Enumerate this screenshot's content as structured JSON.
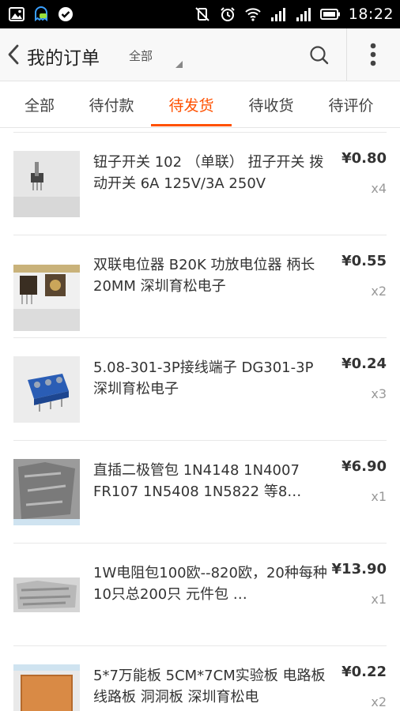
{
  "status_bar": {
    "time": "18:22",
    "icons": [
      "image-icon",
      "ghost-assistant-icon",
      "check-circle-icon",
      "mute-vibrate-icon",
      "alarm-icon",
      "wifi-icon",
      "signal-icon",
      "signal-icon",
      "battery-icon"
    ]
  },
  "header": {
    "back_icon": "chevron-left-icon",
    "title": "我的订单",
    "filter_label": "全部",
    "search_icon": "search-icon",
    "more_icon": "more-vertical-icon"
  },
  "tabs": [
    {
      "label": "全部",
      "active": false
    },
    {
      "label": "待付款",
      "active": false
    },
    {
      "label": "待发货",
      "active": true
    },
    {
      "label": "待收货",
      "active": false
    },
    {
      "label": "待评价",
      "active": false
    }
  ],
  "accent_color": "#ff5000",
  "orders": [
    {
      "title": "钮子开关 102 （单联） 扭子开关 拨动开关 6A 125V/3A 250V",
      "price": "¥0.80",
      "qty": "x4"
    },
    {
      "title": "双联电位器 B20K 功放电位器 柄长20MM 深圳育松电子",
      "price": "¥0.55",
      "qty": "x2"
    },
    {
      "title": "5.08-301-3P接线端子 DG301-3P  深圳育松电子",
      "price": "¥0.24",
      "qty": "x3"
    },
    {
      "title": "直插二极管包 1N4148 1N4007 FR107 1N5408 1N5822 等8…",
      "price": "¥6.90",
      "qty": "x1"
    },
    {
      "title": "1W电阻包100欧--820欧，20种每种10只总200只 元件包 …",
      "price": "¥13.90",
      "qty": "x1"
    },
    {
      "title": "5*7万能板 5CM*7CM实验板 电路板 线路板  洞洞板 深圳育松电",
      "price": "¥0.22",
      "qty": "x2"
    }
  ]
}
